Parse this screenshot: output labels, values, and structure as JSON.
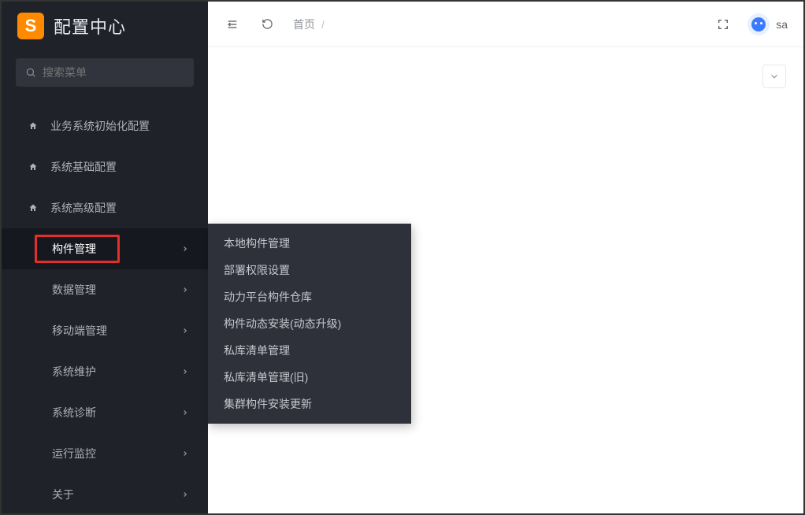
{
  "app": {
    "title": "配置中心"
  },
  "search": {
    "placeholder": "搜索菜单"
  },
  "sidebar": {
    "top_items": [
      {
        "label": "业务系统初始化配置"
      },
      {
        "label": "系统基础配置"
      },
      {
        "label": "系统高级配置"
      }
    ],
    "sub_items": [
      {
        "label": "构件管理",
        "active": true
      },
      {
        "label": "数据管理"
      },
      {
        "label": "移动端管理"
      },
      {
        "label": "系统维护"
      },
      {
        "label": "系统诊断"
      },
      {
        "label": "运行监控"
      },
      {
        "label": "关于"
      }
    ]
  },
  "submenu": {
    "items": [
      {
        "label": "本地构件管理"
      },
      {
        "label": "部署权限设置"
      },
      {
        "label": "动力平台构件仓库"
      },
      {
        "label": "构件动态安装(动态升级)"
      },
      {
        "label": "私库清单管理"
      },
      {
        "label": "私库清单管理(旧)"
      },
      {
        "label": "集群构件安装更新"
      }
    ]
  },
  "breadcrumb": {
    "home": "首页",
    "sep": "/"
  },
  "user": {
    "name": "sa"
  }
}
